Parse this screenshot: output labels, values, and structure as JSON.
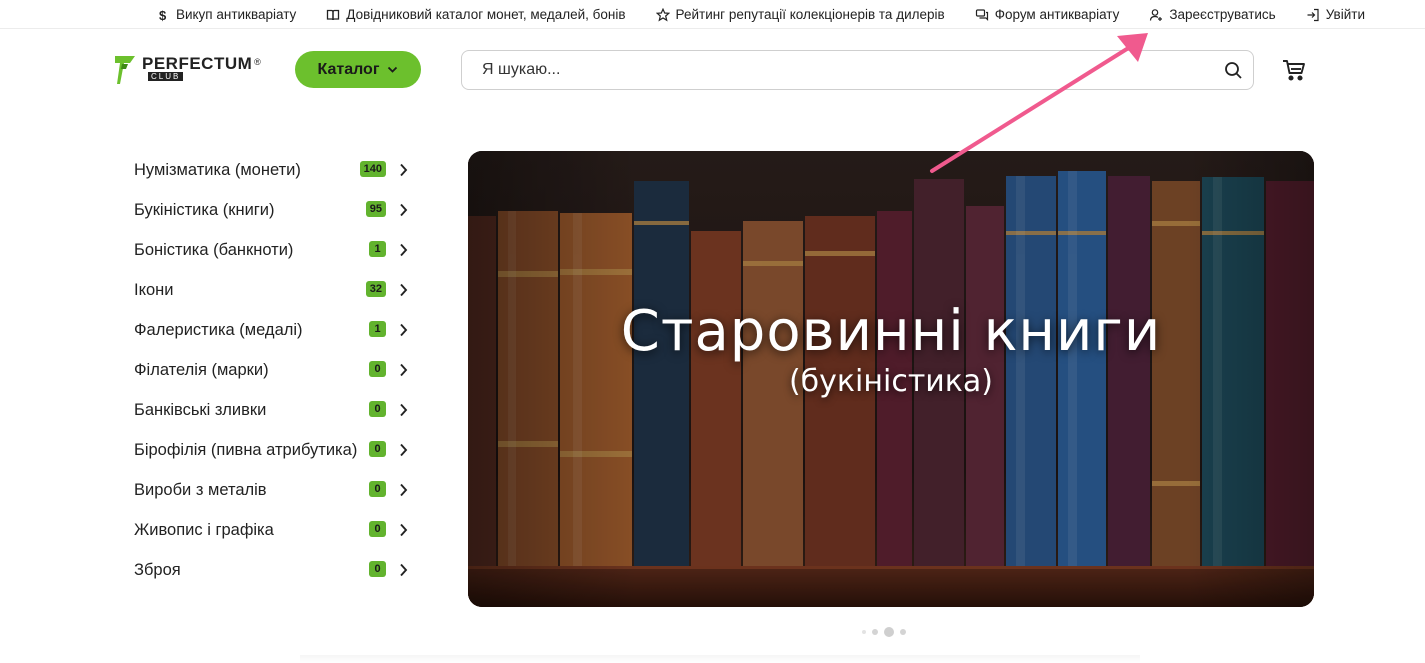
{
  "top_nav": [
    {
      "icon": "dollar-icon",
      "label": "Викуп антикваріату"
    },
    {
      "icon": "book-icon",
      "label": "Довідниковий каталог монет, медалей, бонів"
    },
    {
      "icon": "star-icon",
      "label": "Рейтинг репутації колекціонерів та дилерів"
    },
    {
      "icon": "chat-icon",
      "label": "Форум антикваріату"
    },
    {
      "icon": "user-add-icon",
      "label": "Зареєструватись"
    },
    {
      "icon": "login-icon",
      "label": "Увійти"
    }
  ],
  "header": {
    "logo_text": "PERFECTUM",
    "logo_sub": "CLUB",
    "logo_reg": "®",
    "catalog_label": "Каталог",
    "search_placeholder": "Я шукаю..."
  },
  "categories": [
    {
      "name": "Нумізматика (монети)",
      "count": "140"
    },
    {
      "name": "Букіністика (книги)",
      "count": "95"
    },
    {
      "name": "Боністика (банкноти)",
      "count": "1"
    },
    {
      "name": "Ікони",
      "count": "32"
    },
    {
      "name": "Фалеристика (медалі)",
      "count": "1"
    },
    {
      "name": "Філателія (марки)",
      "count": "0"
    },
    {
      "name": "Банківські зливки",
      "count": "0"
    },
    {
      "name": "Бірофілія (пивна атрибутика)",
      "count": "0"
    },
    {
      "name": "Вироби з металів",
      "count": "0"
    },
    {
      "name": "Живопис і графіка",
      "count": "0"
    },
    {
      "name": "Зброя",
      "count": "0"
    }
  ],
  "banner": {
    "title": "Старовинні книги",
    "subtitle": "(букіністика)"
  },
  "carousel": {
    "count": 4,
    "active": 2
  },
  "colors": {
    "accent": "#6cc02d",
    "badge": "#62b32e",
    "annotation_arrow": "#f05a8e"
  }
}
